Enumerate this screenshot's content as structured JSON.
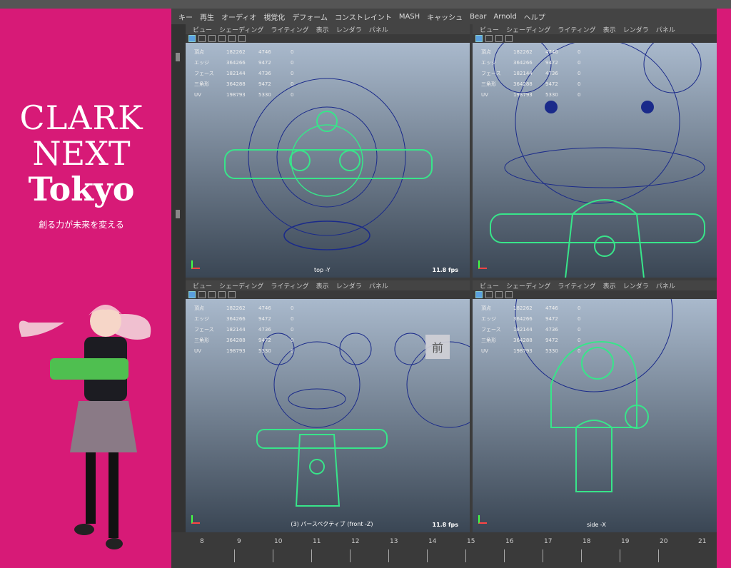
{
  "brand": {
    "title_line1": "CLARK",
    "title_line2": "NEXT",
    "title_line3": "Tokyo",
    "tagline": "創る力が未来を変える"
  },
  "menubar": {
    "items": [
      "キー",
      "再生",
      "オーディオ",
      "視覚化",
      "デフォーム",
      "コンストレイント",
      "MASH",
      "キャッシュ",
      "Bear",
      "Arnold",
      "ヘルプ"
    ]
  },
  "panel_menu": [
    "ビュー",
    "シェーディング",
    "ライティング",
    "表示",
    "レンダラ",
    "パネル"
  ],
  "stats_labels": [
    "頂点",
    "エッジ",
    "フェース",
    "三角形",
    "UV"
  ],
  "stats_values": [
    [
      "182262",
      "4746",
      "0"
    ],
    [
      "364266",
      "9472",
      "0"
    ],
    [
      "182144",
      "4736",
      "0"
    ],
    [
      "364288",
      "9472",
      "0"
    ],
    [
      "198793",
      "5330",
      "0"
    ]
  ],
  "viewports": {
    "top": {
      "label": "top -Y",
      "fps": "11.8 fps"
    },
    "persp": {
      "label": "",
      "fps": ""
    },
    "front": {
      "label": "ㅤ(3) パースペクティブ (front -Z)",
      "fps": "11.8 fps",
      "view_button": "前"
    },
    "side": {
      "label": "side -X",
      "fps": ""
    }
  },
  "timeline": {
    "frames": [
      "8",
      "9",
      "10",
      "11",
      "12",
      "13",
      "14",
      "15",
      "16",
      "17",
      "18",
      "19",
      "20",
      "21"
    ]
  },
  "colors": {
    "brand": "#d71a77",
    "wire_green": "#38e58a",
    "wire_blue": "#1a2a8a"
  }
}
